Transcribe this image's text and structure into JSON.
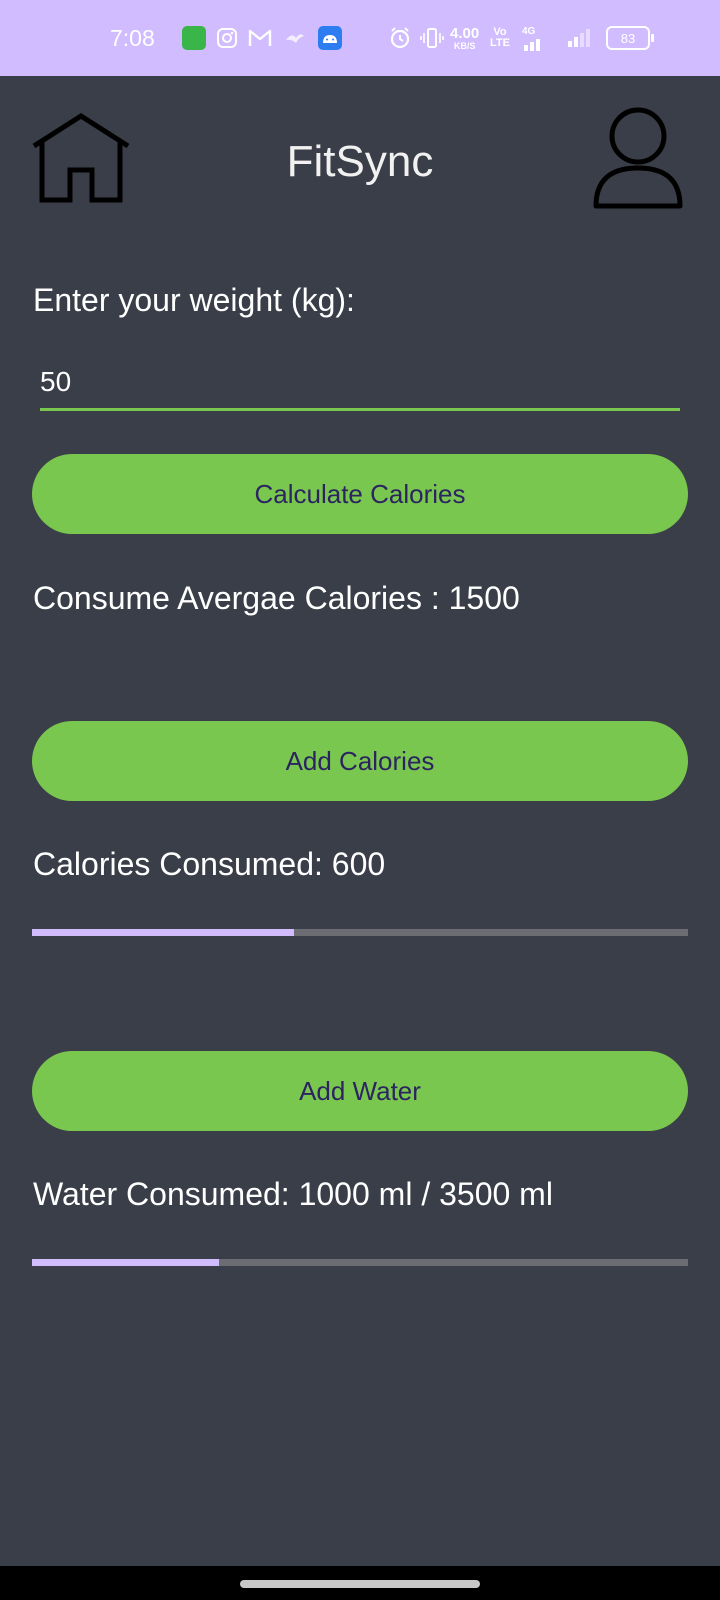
{
  "status_bar": {
    "time": "7:08",
    "network_speed_value": "4.00",
    "network_speed_unit": "KB/S",
    "volte_top": "Vo",
    "volte_bottom": "LTE",
    "network_type": "4G",
    "battery": "83",
    "colors": {
      "background": "#d0bcff"
    }
  },
  "header": {
    "title": "FitSync",
    "home_icon": "home-icon",
    "profile_icon": "profile-icon"
  },
  "weight": {
    "label": "Enter your weight (kg):",
    "value": "50"
  },
  "buttons": {
    "calculate": "Calculate Calories",
    "add_calories": "Add Calories",
    "add_water": "Add Water"
  },
  "results": {
    "average_calories": "Consume Avergae Calories : 1500",
    "calories_consumed": "Calories Consumed: 600",
    "water_consumed": "Water Consumed: 1000 ml / 3500 ml"
  },
  "progress": {
    "calories_fraction": 0.4,
    "water_fraction": 0.2857
  },
  "colors": {
    "background": "#3a3e48",
    "accent": "#7ac74f",
    "button_text": "#2b2461",
    "progress_fill": "#d0bcff",
    "progress_track": "#6c6d73"
  }
}
